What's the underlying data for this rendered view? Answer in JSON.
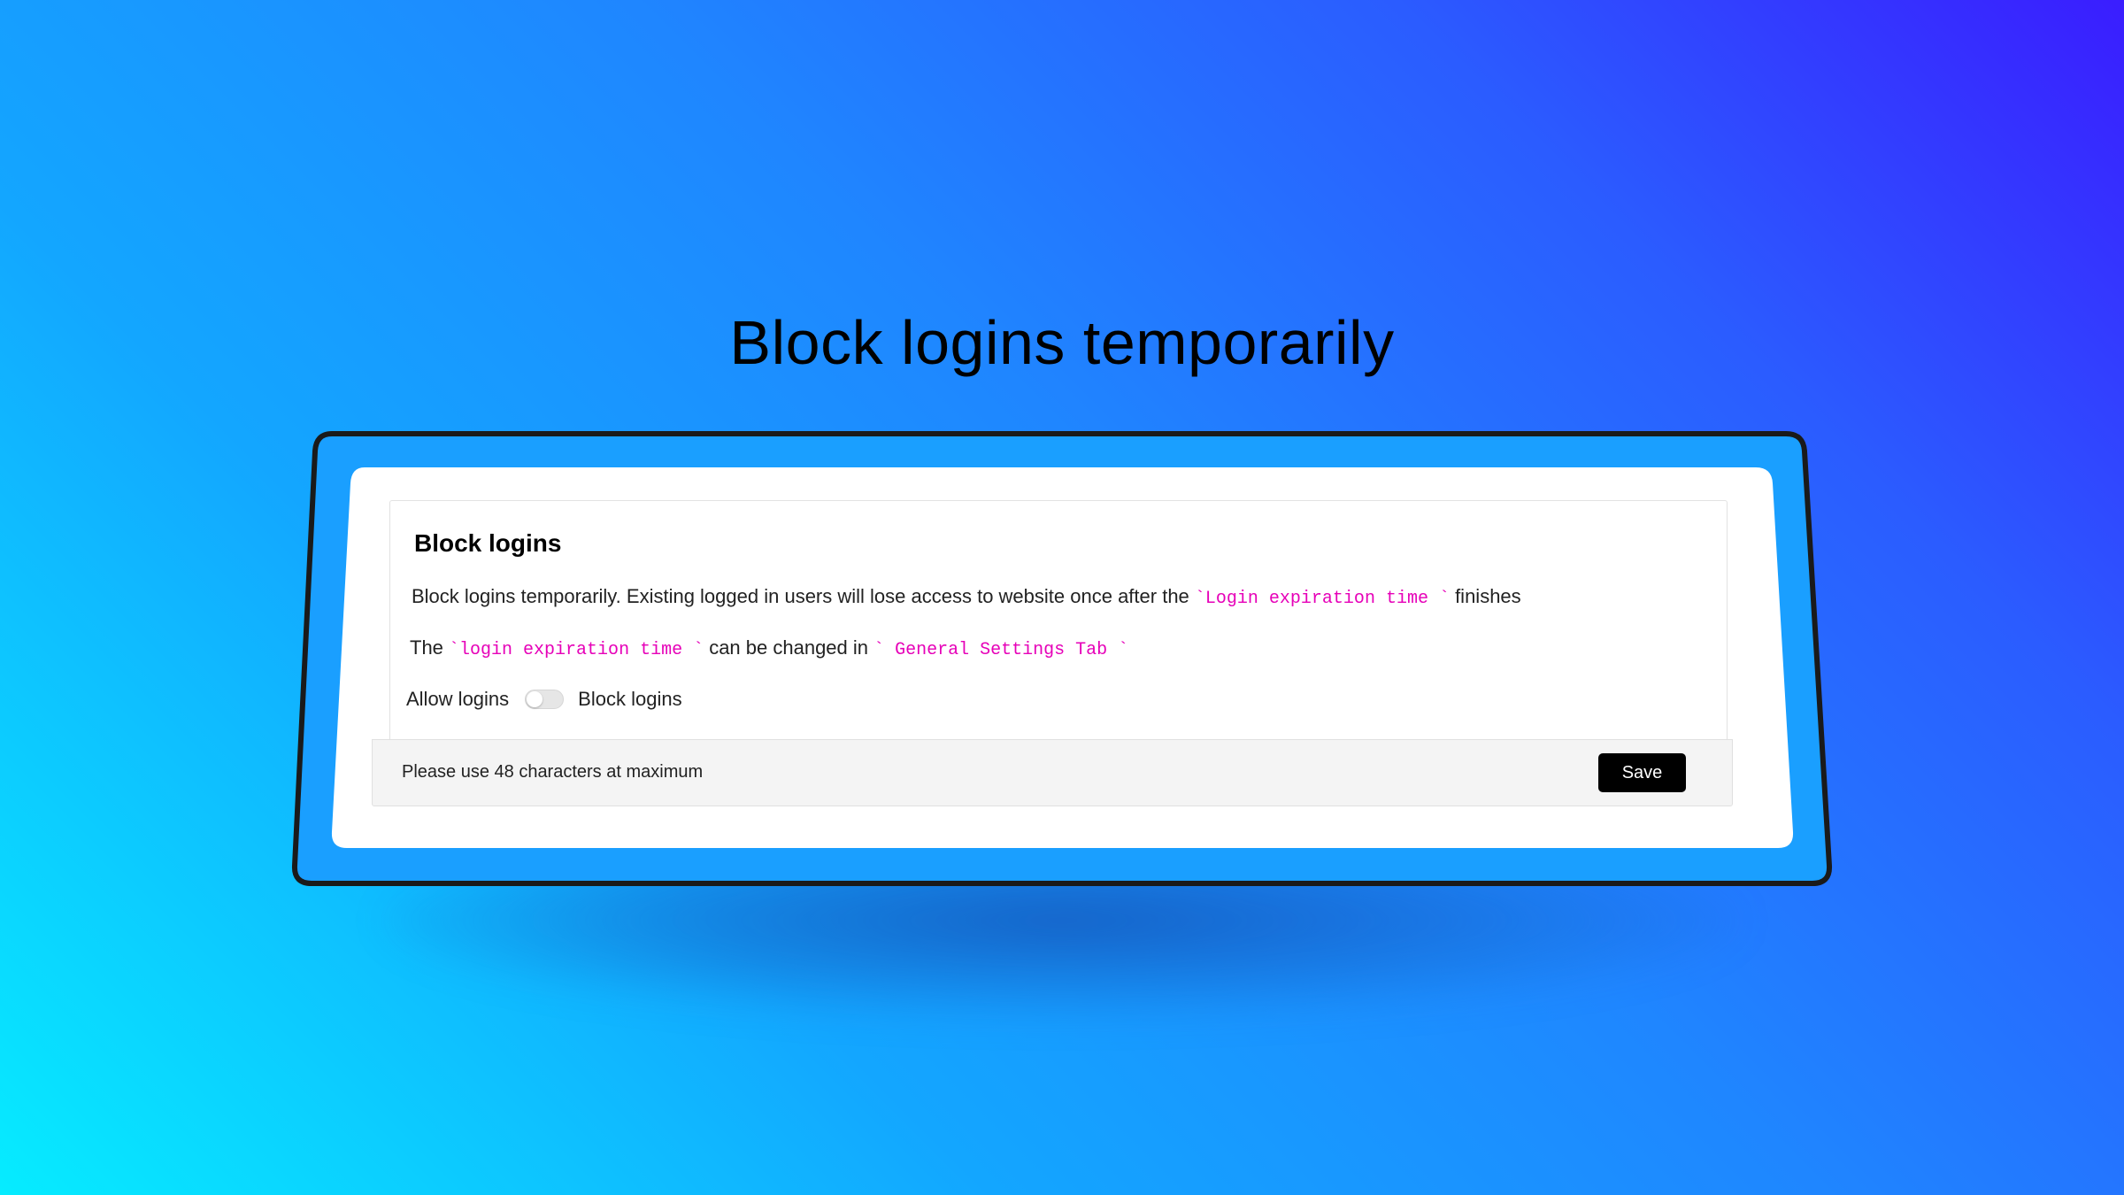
{
  "hero": {
    "title": "Block logins temporarily"
  },
  "colors": {
    "code_accent": "#e600b8",
    "frame_stroke": "#1a1a1a",
    "frame_fill": "#1aa2ff",
    "save_button_bg": "#000000"
  },
  "card": {
    "title": "Block logins",
    "description": {
      "line1_prefix": "Block logins temporarily. Existing logged in users will lose access to website once after the ",
      "line1_code": "`Login expiration time `",
      "line1_suffix": " finishes",
      "line2_prefix": "The ",
      "line2_code1": "`login expiration time `",
      "line2_middle": " can be changed in ",
      "line2_code2": "` General Settings Tab `"
    },
    "toggle": {
      "left_label": "Allow logins",
      "right_label": "Block logins",
      "state": "off"
    },
    "footer": {
      "hint": "Please use 48 characters at maximum",
      "save_label": "Save"
    }
  }
}
